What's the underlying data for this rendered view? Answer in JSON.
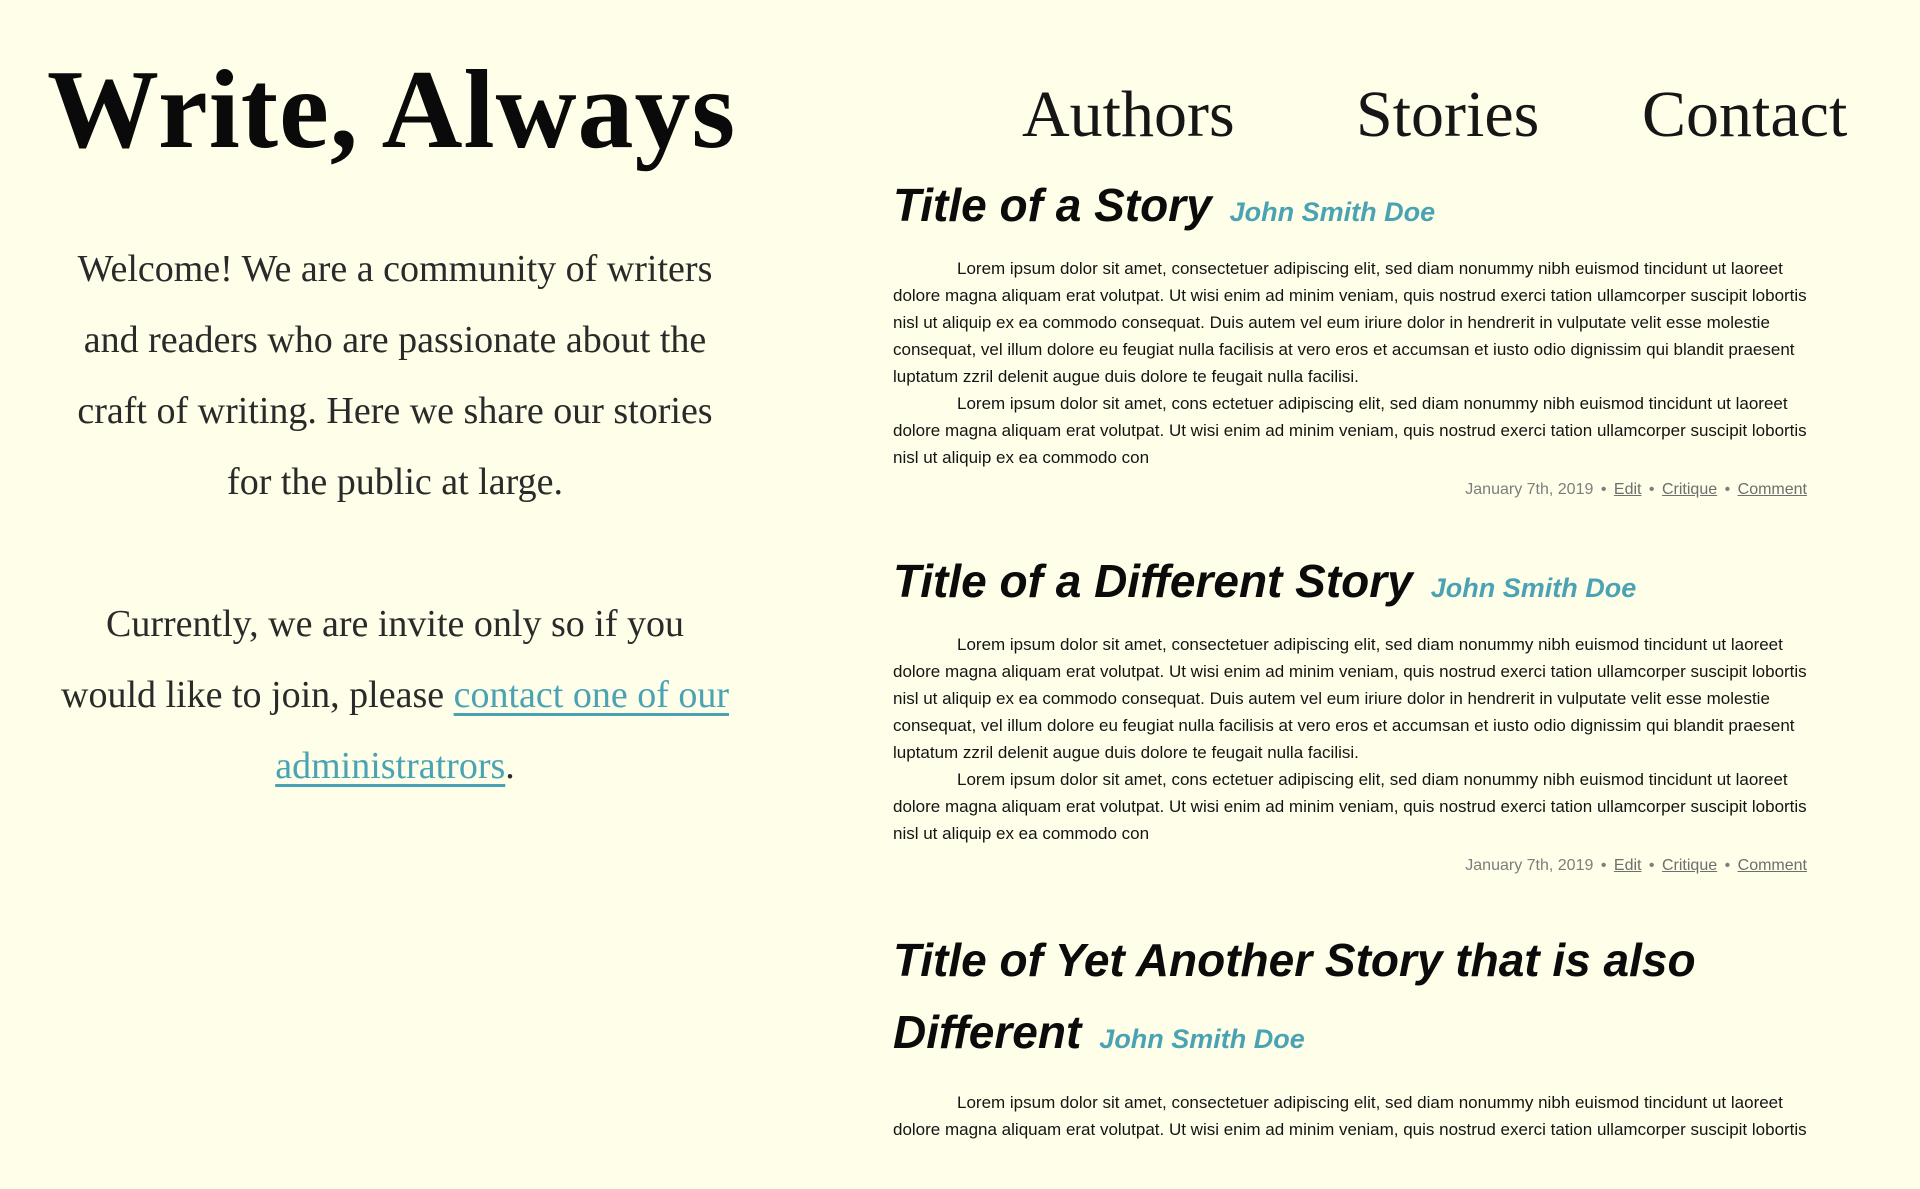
{
  "site": {
    "title": "Write, Always"
  },
  "nav": {
    "authors": "Authors",
    "stories": "Stories",
    "contact": "Contact"
  },
  "intro": {
    "welcome": "Welcome! We are a community of writers and readers who are passionate about the craft of writing. Here we share our stories for the public at large.",
    "invite_before": "Currently, we are invite only so if you would like to join, please ",
    "invite_link": "contact one of our administratrors",
    "invite_after": "."
  },
  "colors": {
    "background": "#fefee9",
    "accent": "#4aa3b4",
    "meta": "#7d7d7d"
  },
  "stories": [
    {
      "title": "Title of a Story",
      "author": "John Smith Doe",
      "paragraphs": [
        "Lorem ipsum dolor sit amet, consectetuer adipiscing elit, sed diam nonummy nibh euismod tincidunt ut laoreet dolore magna aliquam erat volutpat. Ut wisi enim ad minim veniam, quis nostrud exerci tation ullamcorper suscipit lobortis nisl ut aliquip ex ea commodo consequat. Duis autem vel eum iriure dolor in hendrerit in vulputate velit esse molestie consequat, vel illum dolore eu feugiat nulla facilisis at vero eros et accumsan et iusto odio dignissim qui blandit praesent luptatum zzril delenit augue duis dolore te feugait nulla facilisi.",
        "Lorem ipsum dolor sit amet, cons ectetuer adipiscing elit, sed diam nonummy nibh euismod tincidunt ut laoreet dolore magna aliquam erat volutpat. Ut wisi enim ad minim veniam, quis nostrud exerci tation ullamcorper suscipit lobortis nisl ut aliquip ex ea commodo con"
      ],
      "date": "January 7th, 2019",
      "sep": "•",
      "edit": "Edit",
      "critique": "Critique",
      "comment": "Comment"
    },
    {
      "title": "Title of a Different Story",
      "author": "John Smith Doe",
      "paragraphs": [
        "Lorem ipsum dolor sit amet, consectetuer adipiscing elit, sed diam nonummy nibh euismod tincidunt ut laoreet dolore magna aliquam erat volutpat. Ut wisi enim ad minim veniam, quis nostrud exerci tation ullamcorper suscipit lobortis nisl ut aliquip ex ea commodo consequat. Duis autem vel eum iriure dolor in hendrerit in vulputate velit esse molestie consequat, vel illum dolore eu feugiat nulla facilisis at vero eros et accumsan et iusto odio dignissim qui blandit praesent luptatum zzril delenit augue duis dolore te feugait nulla facilisi.",
        "Lorem ipsum dolor sit amet, cons ectetuer adipiscing elit, sed diam nonummy nibh euismod tincidunt ut laoreet dolore magna aliquam erat volutpat. Ut wisi enim ad minim veniam, quis nostrud exerci tation ullamcorper suscipit lobortis nisl ut aliquip ex ea commodo con"
      ],
      "date": "January 7th, 2019",
      "sep": "•",
      "edit": "Edit",
      "critique": "Critique",
      "comment": "Comment"
    },
    {
      "title": "Title of Yet Another Story that is also Different",
      "author": "John Smith Doe",
      "paragraphs": [
        "Lorem ipsum dolor sit amet, consectetuer adipiscing elit, sed diam nonummy nibh euismod tincidunt ut laoreet dolore magna aliquam erat volutpat. Ut wisi enim ad minim veniam, quis nostrud exerci tation ullamcorper suscipit lobortis"
      ]
    }
  ]
}
